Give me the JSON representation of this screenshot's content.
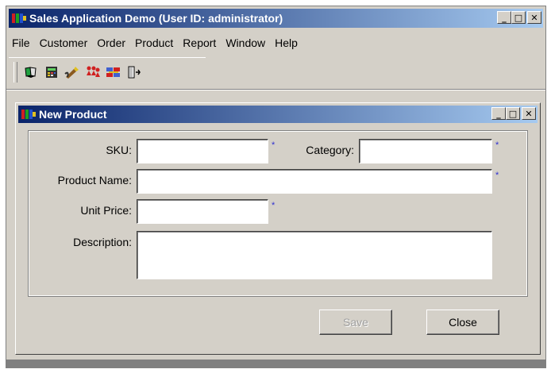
{
  "window": {
    "title": "Sales Application Demo (User ID: administrator)",
    "controls": {
      "minimize": "_",
      "maximize": "□",
      "close": "✕"
    }
  },
  "menu": [
    "File",
    "Customer",
    "Order",
    "Product",
    "Report",
    "Window",
    "Help"
  ],
  "toolbar": {
    "icons": [
      "book-icon",
      "calculator-icon",
      "pencil-icon",
      "people-icon",
      "transfer-icon",
      "exit-door-icon"
    ]
  },
  "child": {
    "title": "New Product",
    "form": {
      "sku_label": "SKU:",
      "sku_value": "",
      "category_label": "Category:",
      "category_value": "",
      "name_label": "Product Name:",
      "name_value": "",
      "price_label": "Unit Price:",
      "price_value": "",
      "description_label": "Description:",
      "description_value": "",
      "required_marker": "*"
    },
    "buttons": {
      "save": "Save",
      "close": "Close"
    }
  },
  "colors": {
    "title_start": "#0a246a",
    "title_end": "#a6caf0",
    "face": "#d4d0c8",
    "required": "#3030d0"
  }
}
